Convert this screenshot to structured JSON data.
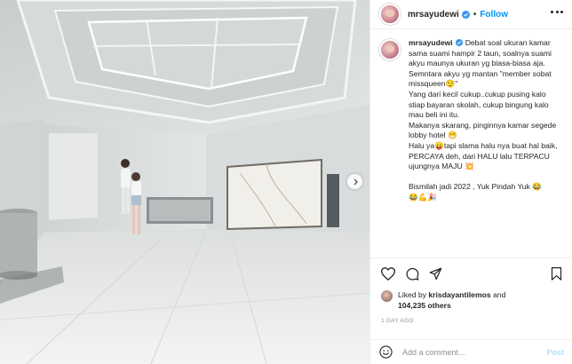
{
  "post": {
    "username": "mrsayudewi",
    "follow_label": "Follow",
    "separator": "•",
    "caption": "Debat soal ukuran kamar sama suami hampir 2 taun, soalnya suami akyu maunya ukuran yg biasa-biasa aja.\nSemntara akyu yg mantan \"member sobat missqueen😌\"\nYang dari kecil cukup..cukup pusing kalo stiap bayaran skolah, cukup bingung kalo mau beli ini itu.\nMakanya skarang, pinginnya kamar segede lobby hotel 😁\nHalu ya😛tapi slama halu nya buat hal baik, PERCAYA deh, dari HALU lalu TERPACU ujungnya MAJU 💥\n\nBismilah jadi 2022 , Yuk Pindah Yuk 😂\n😂💪🎉",
    "liked_by_prefix": "Liked by ",
    "liked_by_user": "krisdayantilemos",
    "liked_by_and": " and",
    "likes_count": "104,235",
    "likes_suffix": " others",
    "timestamp": "1 DAY AGO",
    "comment_placeholder": "Add a comment...",
    "post_label": "Post"
  },
  "icons": {
    "verified": "verified-badge-icon",
    "more": "more-options-icon",
    "like": "heart-icon",
    "comment": "comment-icon",
    "share": "share-icon",
    "save": "bookmark-icon",
    "emoji": "emoji-icon",
    "next": "chevron-right-icon"
  },
  "colors": {
    "accent": "#0095f6",
    "text": "#262626",
    "muted": "#8e8e8e",
    "border": "#efefef",
    "post_disabled": "#b2dffc"
  }
}
